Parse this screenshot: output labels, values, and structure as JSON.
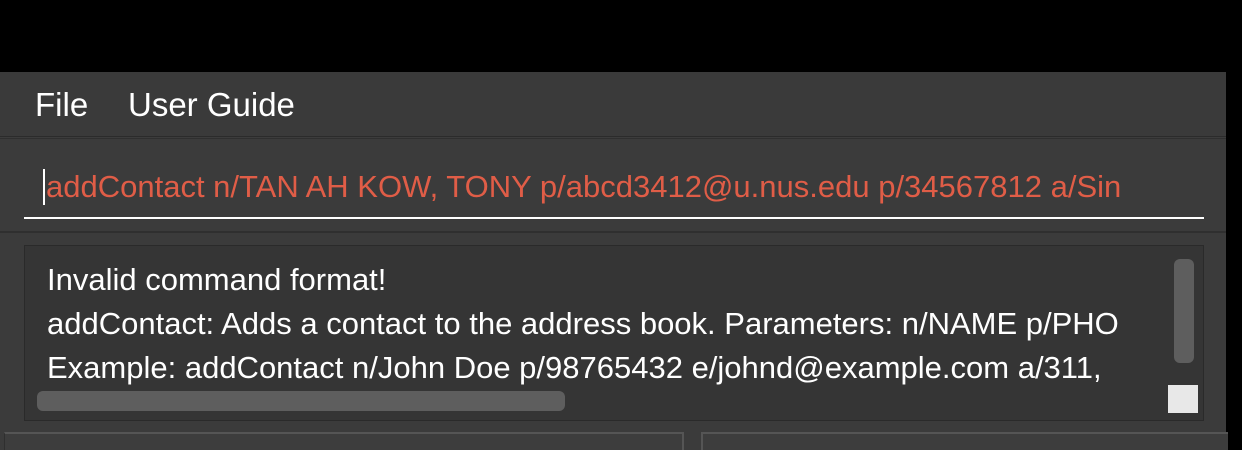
{
  "menubar": {
    "items": [
      "File",
      "User Guide"
    ]
  },
  "command_box": {
    "value": "addContact n/TAN AH KOW, TONY p/abcd3412@u.nus.edu p/34567812 a/Sin",
    "text_color": "#e05d47"
  },
  "result_display": {
    "lines": [
      "Invalid command format!",
      "addContact: Adds a contact to the address book. Parameters: n/NAME p/PHO",
      "Example: addContact n/John Doe p/98765432 e/johnd@example.com a/311,"
    ]
  },
  "theme": {
    "background": "#3c3c3c",
    "text": "#ffffff"
  }
}
